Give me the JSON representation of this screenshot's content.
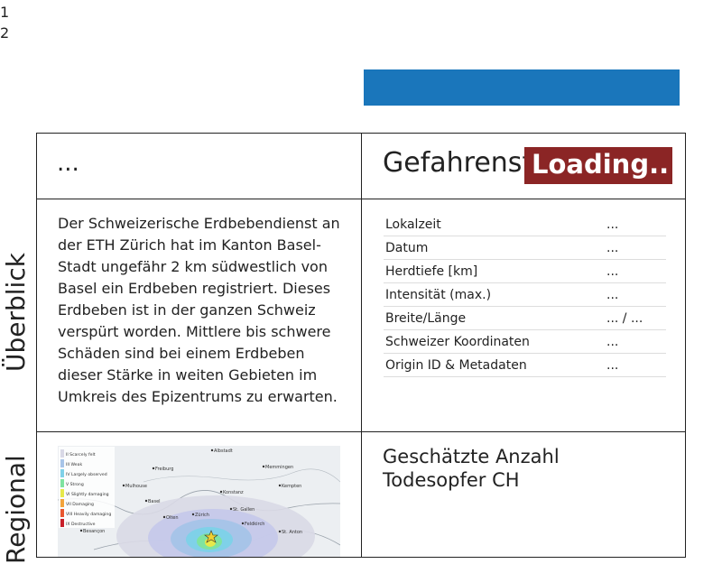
{
  "line_numbers": [
    "1",
    "2"
  ],
  "colors": {
    "top_bar": "#1a76bb",
    "loading_badge": "#8b2525"
  },
  "header": {
    "left_placeholder": "...",
    "title": "Gefahrenstufe",
    "loading": "Loading.."
  },
  "side_labels": {
    "overview": "Überblick",
    "regional": "Regional"
  },
  "description": "Der Schweizerische Erdbebendienst an der ETH Zürich hat im Kanton Basel-Stadt ungefähr 2 km südwestlich von Basel ein Erdbeben registriert. Dieses Erdbeben ist in der ganzen Schweiz verspürt worden. Mittlere bis schwere Schäden sind bei einem Erdbeben dieser Stärke in weiten Gebieten im Umkreis des Epizentrums zu erwarten.",
  "info_table": [
    {
      "label": "Lokalzeit",
      "value": "..."
    },
    {
      "label": "Datum",
      "value": "..."
    },
    {
      "label": "Herdtiefe [km]",
      "value": "..."
    },
    {
      "label": "Intensität (max.)",
      "value": "..."
    },
    {
      "label": "Breite/Länge",
      "value": "... / ..."
    },
    {
      "label": "Schweizer Koordinaten",
      "value": "..."
    },
    {
      "label": "Origin ID & Metadaten",
      "value": "..."
    }
  ],
  "map": {
    "legend": [
      {
        "label": "II Scarcely felt",
        "color": "#d9d9e6"
      },
      {
        "label": "III Weak",
        "color": "#a7c4e8"
      },
      {
        "label": "IV Largely observed",
        "color": "#7fd1e8"
      },
      {
        "label": "V Strong",
        "color": "#7fe3a0"
      },
      {
        "label": "VI Slightly damaging",
        "color": "#e6e84a"
      },
      {
        "label": "VII Damaging",
        "color": "#f3a33a"
      },
      {
        "label": "VIII Heavily damaging",
        "color": "#e8562e"
      },
      {
        "label": "IX Destructive",
        "color": "#c8202a"
      }
    ],
    "cities": [
      "Albstadt",
      "Freiburg",
      "Memmingen",
      "Mulhouse",
      "Basel",
      "Konstanz",
      "Kempten",
      "Olten",
      "Zürich",
      "St. Gallen",
      "Feldkirch",
      "Besançon",
      "St. Anton"
    ]
  },
  "deaths": {
    "title": "Geschätzte Anzahl Todesopfer CH"
  }
}
